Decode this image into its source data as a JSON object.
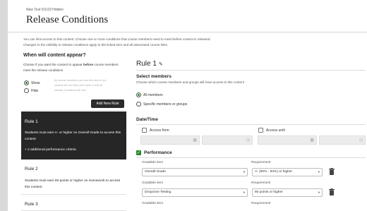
{
  "header": {
    "subtitle": "New Test 6/1/23 Hidden",
    "title": "Release Conditions",
    "close_glyph": "×"
  },
  "intro": {
    "line1": "You can limit access to this content. Choose one or more conditions that course members need to meet before content is released.",
    "line2": "Changes to the visibility or release conditions apply to the linked item and all associated course links."
  },
  "when": {
    "title": "When will content appear?",
    "desc_prefix": "Choose if you want the content to appear ",
    "desc_bold": "before",
    "desc_suffix": " course members meet the release conditions",
    "show_label": "Show",
    "hide_label": "Hide",
    "show_note": "All course members can see this item in the content list, but they can't open it until all release conditions are met.",
    "add_rule_label": "Add New Rule"
  },
  "rules": [
    {
      "name": "Rule 1",
      "desc": "Students must earn A- or higher on Overall Grade to access this content",
      "extra": "+ 2 additional performance criteria"
    },
    {
      "name": "Rule 2",
      "desc": "Students must earn 80 points or higher on Homework to access this content"
    },
    {
      "name": "Rule 3"
    }
  ],
  "editor": {
    "rule_title": "Rule 1",
    "pencil_glyph": "✎",
    "select_members_title": "Select members",
    "select_members_desc": "Choose which course members and groups will have access to this content",
    "all_members_label": "All members",
    "specific_members_label": "Specific members or groups",
    "datetime_title": "Date/Time",
    "access_from_label": "Access from",
    "access_until_label": "Access until",
    "calendar_glyph": "▦",
    "clock_glyph": "◷",
    "performance_title": "Performance",
    "check_glyph": "✓",
    "gradable_item_header": "Gradable item",
    "requirement_header": "Requirement",
    "caret_glyph": "▾",
    "perf_rows": [
      {
        "item": "Overall Grade",
        "requirement": "A- (90% - 94%) or higher"
      },
      {
        "item": "Dropzone Testing",
        "requirement": "80 points or higher"
      }
    ]
  },
  "colors": {
    "accent_purple": "#b45fd6",
    "active_rule_bg": "#262626",
    "check_green": "#2a8a2a"
  }
}
